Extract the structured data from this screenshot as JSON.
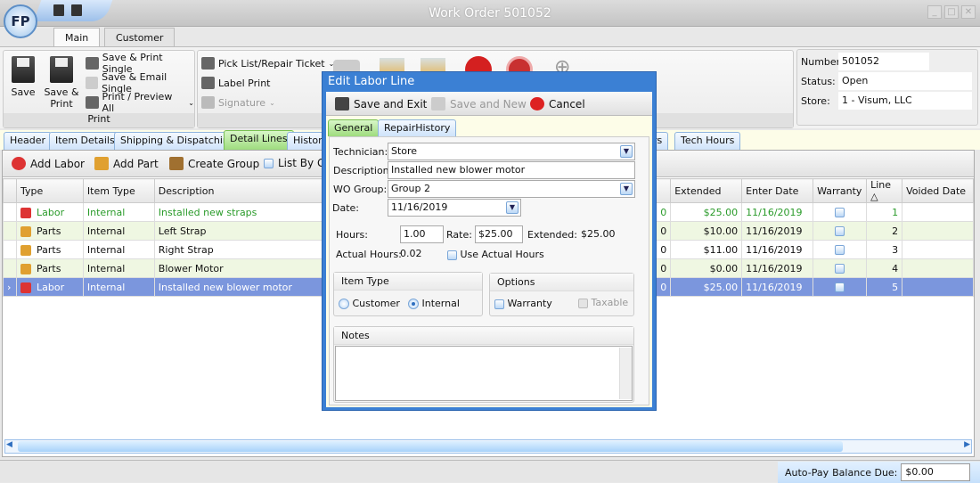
{
  "window": {
    "title": "Work Order 501052",
    "logo_text": "FP"
  },
  "ribbon": {
    "tabs": [
      "Main",
      "Customer"
    ],
    "print_group": {
      "label": "Print",
      "save": "Save",
      "save_print": "Save &\nPrint",
      "save_print_single": "Save & Print Single",
      "save_email_single": "Save & Email Single",
      "print_preview_all": "Print / Preview All"
    },
    "group2": {
      "pick_list": "Pick List/Repair Ticket",
      "label_print": "Label Print",
      "signature": "Signature"
    }
  },
  "info": {
    "number_label": "Number:",
    "number": "501052",
    "status_label": "Status:",
    "status": "Open",
    "store_label": "Store:",
    "store": "1 - Visum, LLC"
  },
  "subtabs": [
    "Header",
    "Item Details",
    "Shipping & Dispatching",
    "Detail Lines",
    "History",
    "rs",
    "Tech Hours"
  ],
  "toolbar": {
    "add_labor": "Add Labor",
    "add_part": "Add Part",
    "create_group": "Create Group",
    "list_by": "List By G"
  },
  "grid": {
    "columns": [
      "Type",
      "Item Type",
      "Description",
      "Extended",
      "Enter Date",
      "Warranty",
      "Line △",
      "Voided Date"
    ],
    "rows": [
      {
        "type": "Labor",
        "item_type": "Internal",
        "description": "Installed new straps",
        "hidden": "0",
        "extended": "$25.00",
        "enter_date": "11/16/2019",
        "warranty": false,
        "line": "1",
        "voided_date": ""
      },
      {
        "type": "Parts",
        "item_type": "Internal",
        "description": "Left Strap",
        "hidden": "0",
        "extended": "$10.00",
        "enter_date": "11/16/2019",
        "warranty": false,
        "line": "2",
        "voided_date": ""
      },
      {
        "type": "Parts",
        "item_type": "Internal",
        "description": "Right Strap",
        "hidden": "0",
        "extended": "$11.00",
        "enter_date": "11/16/2019",
        "warranty": false,
        "line": "3",
        "voided_date": ""
      },
      {
        "type": "Parts",
        "item_type": "Internal",
        "description": "Blower Motor",
        "hidden": "0",
        "extended": "$0.00",
        "enter_date": "11/16/2019",
        "warranty": false,
        "line": "4",
        "voided_date": ""
      },
      {
        "type": "Labor",
        "item_type": "Internal",
        "description": "Installed new blower motor",
        "hidden": "0",
        "extended": "$25.00",
        "enter_date": "11/16/2019",
        "warranty": false,
        "line": "5",
        "voided_date": ""
      }
    ]
  },
  "status": {
    "auto_pay": "Auto-Pay",
    "balance_label": "Balance Due:",
    "balance": "$0.00"
  },
  "dialog": {
    "title": "Edit Labor Line",
    "save_exit": "Save and Exit",
    "save_new": "Save and New",
    "cancel": "Cancel",
    "tabs": [
      "General",
      "RepairHistory"
    ],
    "technician_label": "Technician:",
    "technician": "Store",
    "description_label": "Description:",
    "description": "Installed new blower motor",
    "wo_group_label": "WO Group:",
    "wo_group": "Group 2",
    "date_label": "Date:",
    "date": "11/16/2019",
    "hours_label": "Hours:",
    "hours": "1.00",
    "rate_label": "Rate:",
    "rate": "$25.00",
    "extended_label": "Extended:",
    "extended": "$25.00",
    "actual_hours_label": "Actual Hours:",
    "actual_hours": "0.02",
    "use_actual_hours": "Use Actual Hours",
    "item_type_label": "Item Type",
    "customer": "Customer",
    "internal": "Internal",
    "item_type_selected": "Internal",
    "options_label": "Options",
    "warranty": "Warranty",
    "taxable": "Taxable",
    "notes_label": "Notes",
    "notes": ""
  },
  "colors": {
    "dialog_border": "#3b80d4",
    "selected_row": "#7b96dd",
    "alt_row": "#eff7e2",
    "active_tab": "#9edc7e",
    "labor_text": "#2a9b2a"
  }
}
